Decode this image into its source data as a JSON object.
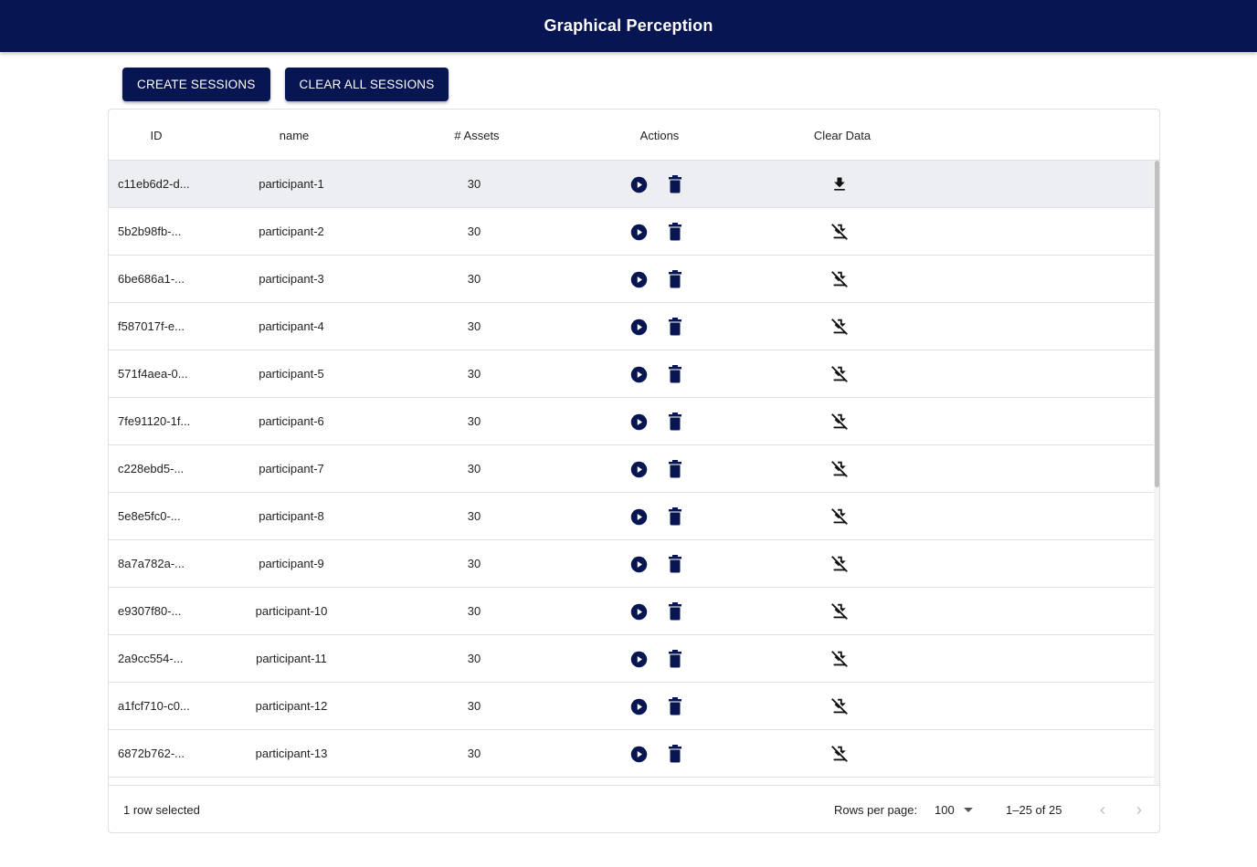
{
  "app": {
    "title": "Graphical Perception"
  },
  "toolbar": {
    "create_label": "CREATE SESSIONS",
    "clear_all_label": "CLEAR ALL SESSIONS"
  },
  "table": {
    "columns": {
      "id": "ID",
      "name": "name",
      "assets": "# Assets",
      "actions": "Actions",
      "clear": "Clear Data"
    },
    "rows": [
      {
        "id": "c11eb6d2-d...",
        "name": "participant-1",
        "assets": "30",
        "clear_icon": "download-icon",
        "selected": true
      },
      {
        "id": "5b2b98fb-...",
        "name": "participant-2",
        "assets": "30",
        "clear_icon": "file-download-off-icon",
        "selected": false
      },
      {
        "id": "6be686a1-...",
        "name": "participant-3",
        "assets": "30",
        "clear_icon": "file-download-off-icon",
        "selected": false
      },
      {
        "id": "f587017f-e...",
        "name": "participant-4",
        "assets": "30",
        "clear_icon": "file-download-off-icon",
        "selected": false
      },
      {
        "id": "571f4aea-0...",
        "name": "participant-5",
        "assets": "30",
        "clear_icon": "file-download-off-icon",
        "selected": false
      },
      {
        "id": "7fe91120-1f...",
        "name": "participant-6",
        "assets": "30",
        "clear_icon": "file-download-off-icon",
        "selected": false
      },
      {
        "id": "c228ebd5-...",
        "name": "participant-7",
        "assets": "30",
        "clear_icon": "file-download-off-icon",
        "selected": false
      },
      {
        "id": "5e8e5fc0-...",
        "name": "participant-8",
        "assets": "30",
        "clear_icon": "file-download-off-icon",
        "selected": false
      },
      {
        "id": "8a7a782a-...",
        "name": "participant-9",
        "assets": "30",
        "clear_icon": "file-download-off-icon",
        "selected": false
      },
      {
        "id": "e9307f80-...",
        "name": "participant-10",
        "assets": "30",
        "clear_icon": "file-download-off-icon",
        "selected": false
      },
      {
        "id": "2a9cc554-...",
        "name": "participant-11",
        "assets": "30",
        "clear_icon": "file-download-off-icon",
        "selected": false
      },
      {
        "id": "a1fcf710-c0...",
        "name": "participant-12",
        "assets": "30",
        "clear_icon": "file-download-off-icon",
        "selected": false
      },
      {
        "id": "6872b762-...",
        "name": "participant-13",
        "assets": "30",
        "clear_icon": "file-download-off-icon",
        "selected": false
      }
    ],
    "action_icons": [
      "play-circle-icon",
      "trash-icon"
    ]
  },
  "footer": {
    "selection_text": "1 row selected",
    "rows_per_page_label": "Rows per page:",
    "rows_per_page_value": "100",
    "range_text": "1–25 of 25"
  },
  "colors": {
    "primary": "#081553",
    "selected_row": "#edeef2",
    "border": "#e0e0e0"
  }
}
